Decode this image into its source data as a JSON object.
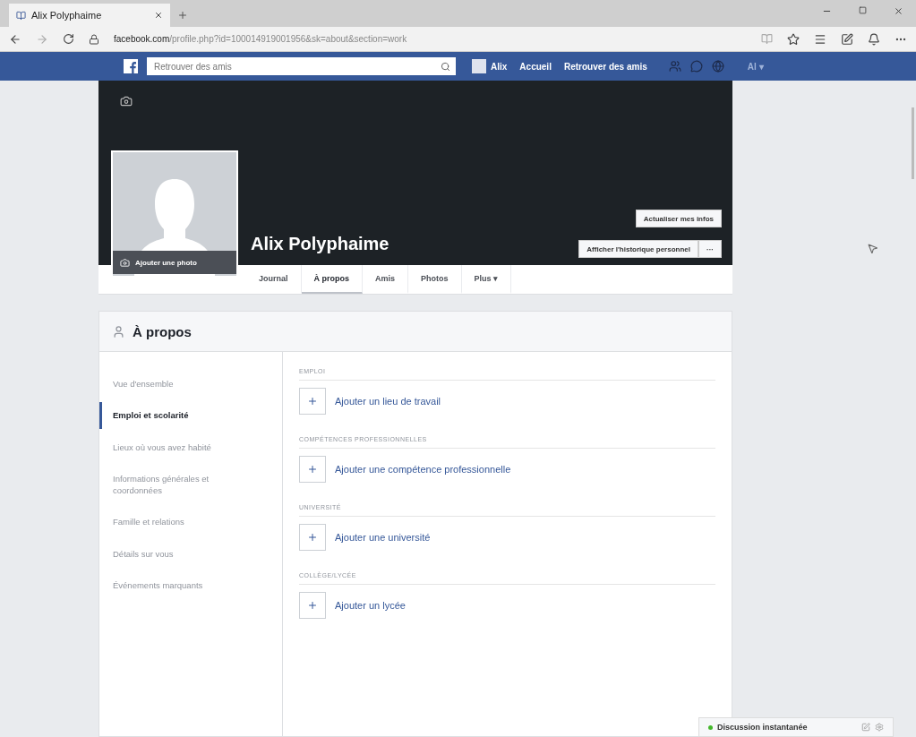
{
  "browser": {
    "tab_title": "Alix Polyphaime",
    "url_host": "facebook.com",
    "url_path": "/profile.php?id=100014919001956&sk=about&section=work"
  },
  "topbar": {
    "search_placeholder": "Retrouver des amis",
    "links": [
      {
        "label": "Alix",
        "kind": "profile"
      },
      {
        "label": "Accueil",
        "kind": "link"
      },
      {
        "label": "Retrouver des amis",
        "kind": "link"
      }
    ],
    "account": "Al ▾"
  },
  "profile": {
    "name": "Alix Polyphaime",
    "add_photo": "Ajouter une photo",
    "update_button": "Actualiser mes infos",
    "history_button": "Afficher l'historique personnel",
    "more_button": "···"
  },
  "tabs": [
    {
      "label": "Journal",
      "selected": false
    },
    {
      "label": "À propos",
      "selected": true
    },
    {
      "label": "Amis",
      "selected": false
    },
    {
      "label": "Photos",
      "selected": false
    },
    {
      "label": "Plus ▾",
      "selected": false
    }
  ],
  "about": {
    "title": "À propos",
    "nav": [
      {
        "label": "Vue d'ensemble",
        "selected": false
      },
      {
        "label": "Emploi et scolarité",
        "selected": true
      },
      {
        "label": "Lieux où vous avez habité",
        "selected": false
      },
      {
        "label": "Informations générales et coordonnées",
        "selected": false
      },
      {
        "label": "Famille et relations",
        "selected": false
      },
      {
        "label": "Détails sur vous",
        "selected": false
      },
      {
        "label": "Événements marquants",
        "selected": false
      }
    ],
    "sections": [
      {
        "heading": "EMPLOI",
        "action": "Ajouter un lieu de travail"
      },
      {
        "heading": "COMPÉTENCES PROFESSIONNELLES",
        "action": "Ajouter une compétence professionnelle"
      },
      {
        "heading": "UNIVERSITÉ",
        "action": "Ajouter une université"
      },
      {
        "heading": "COLLÈGE/LYCÉE",
        "action": "Ajouter un lycée"
      }
    ]
  },
  "chat": {
    "label": "Discussion instantanée",
    "online": true
  }
}
